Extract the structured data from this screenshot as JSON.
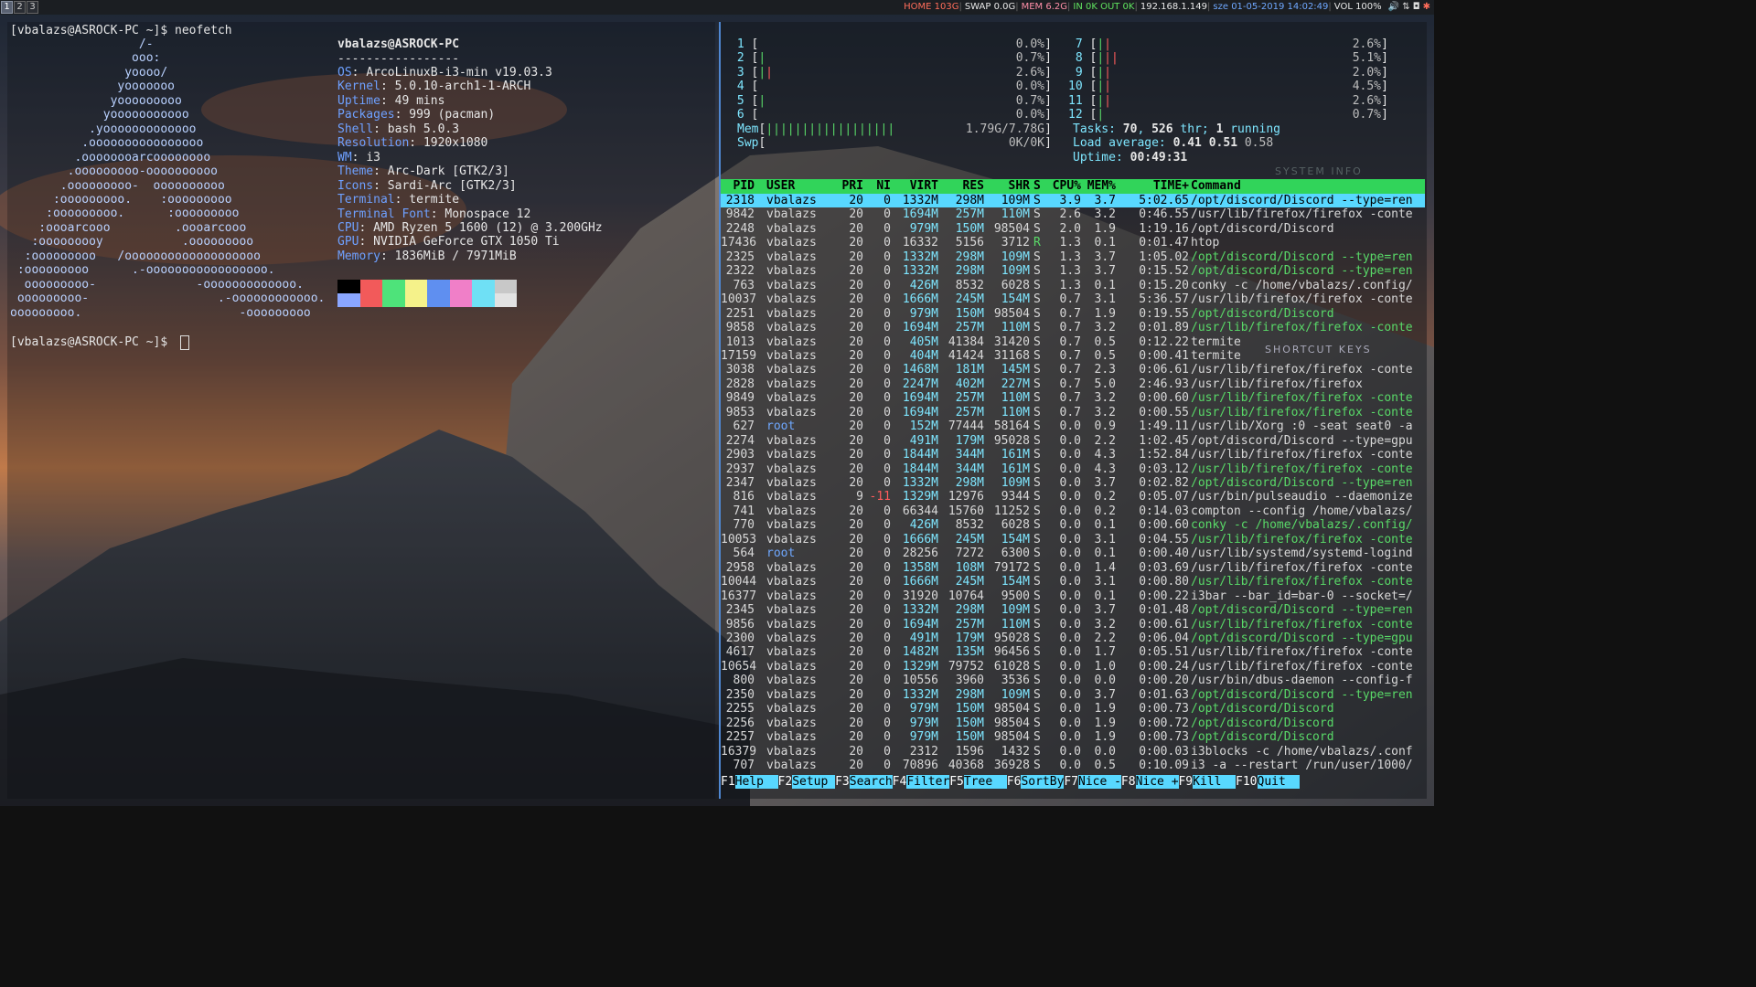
{
  "workspaces": [
    "1",
    "2",
    "3"
  ],
  "status_blocks": [
    {
      "text": "HOME 103G",
      "color": "#ff6d5a"
    },
    {
      "text": "SWAP 0.0G",
      "color": "#e8e8e8"
    },
    {
      "text": "MEM 6.2G",
      "color": "#ff8fa8"
    },
    {
      "text": "IN 0K OUT 0K",
      "color": "#5fe35f"
    },
    {
      "text": "192.168.1.149",
      "color": "#e8e8e8"
    },
    {
      "text": "sze 01-05-2019 14:02:49",
      "color": "#6fa8ff"
    },
    {
      "text": "VOL 100%",
      "color": "#e8e8e8"
    }
  ],
  "terminal": {
    "prompt1": "[vbalazs@ASROCK-PC ~]$ neofetch",
    "prompt2": "[vbalazs@ASROCK-PC ~]$ ",
    "ascii": [
      "                  /-",
      "                 ooo:",
      "                yoooo/",
      "               yooooooo",
      "              yooooooooo",
      "             yooooooooooo",
      "           .yooooooooooooo",
      "          .oooooooooooooooo",
      "         .oooooooarcoooooooo",
      "        .ooooooooo-oooooooooo",
      "       .ooooooooo-  oooooooooo",
      "      :ooooooooo.    :ooooooooo",
      "     :ooooooooo.      :ooooooooo",
      "    :oooarcooo         .oooarcooo",
      "   :ooooooooy           .ooooooooo",
      "  :ooooooooo   /ooooooooooooooooooo",
      " :ooooooooo      .-ooooooooooooooooo.",
      "  ooooooooo-              -ooooooooooooo.",
      " ooooooooo-                  .-oooooooooooo.",
      "ooooooooo.                      -ooooooooo"
    ],
    "user_host": "vbalazs@ASROCK-PC",
    "underline": "-----------------",
    "info": [
      {
        "key": "OS",
        "value": "ArcoLinuxB-i3-min v19.03.3"
      },
      {
        "key": "Kernel",
        "value": "5.0.10-arch1-1-ARCH"
      },
      {
        "key": "Uptime",
        "value": "49 mins"
      },
      {
        "key": "Packages",
        "value": "999 (pacman)"
      },
      {
        "key": "Shell",
        "value": "bash 5.0.3"
      },
      {
        "key": "Resolution",
        "value": "1920x1080"
      },
      {
        "key": "WM",
        "value": "i3"
      },
      {
        "key": "Theme",
        "value": "Arc-Dark [GTK2/3]"
      },
      {
        "key": "Icons",
        "value": "Sardi-Arc [GTK2/3]"
      },
      {
        "key": "Terminal",
        "value": "termite"
      },
      {
        "key": "Terminal Font",
        "value": "Monospace 12"
      },
      {
        "key": "CPU",
        "value": "AMD Ryzen 5 1600 (12) @ 3.200GHz"
      },
      {
        "key": "GPU",
        "value": "NVIDIA GeForce GTX 1050 Ti"
      },
      {
        "key": "Memory",
        "value": "1836MiB / 7971MiB"
      }
    ],
    "palette_top": [
      "#000000",
      "#f25a5a",
      "#4ee37a",
      "#f5f28a",
      "#5f8ff0",
      "#f07fc8",
      "#6fe0f5",
      "#c8c8c8"
    ],
    "palette_bottom": [
      "#8aa6ff",
      "#f25a5a",
      "#4ee37a",
      "#f5f28a",
      "#5f8ff0",
      "#f07fc8",
      "#6fe0f5",
      "#e2e2e2"
    ]
  },
  "htop": {
    "cpus_left": [
      {
        "n": "1",
        "bar": "",
        "pct": "0.0%"
      },
      {
        "n": "2",
        "bar": "|",
        "pct": "0.7%"
      },
      {
        "n": "3",
        "bar": "||",
        "pct": "2.6%"
      },
      {
        "n": "4",
        "bar": "",
        "pct": "0.0%"
      },
      {
        "n": "5",
        "bar": "|",
        "pct": "0.7%"
      },
      {
        "n": "6",
        "bar": "",
        "pct": "0.0%"
      }
    ],
    "cpus_right": [
      {
        "n": "7",
        "bar": "||",
        "pct": "2.6%"
      },
      {
        "n": "8",
        "bar": "|||",
        "pct": "5.1%"
      },
      {
        "n": "9",
        "bar": "||",
        "pct": "2.0%"
      },
      {
        "n": "10",
        "bar": "||",
        "pct": "4.5%"
      },
      {
        "n": "11",
        "bar": "||",
        "pct": "2.6%"
      },
      {
        "n": "12",
        "bar": "|",
        "pct": "0.7%"
      }
    ],
    "mem": {
      "label": "Mem",
      "bar": "||||||||||||||||||",
      "value": "1.79G/7.78G"
    },
    "swp": {
      "label": "Swp",
      "bar": "",
      "value": "0K/0K"
    },
    "tasks": {
      "label": "Tasks: ",
      "tasks": "70",
      "sep": ", ",
      "thr": "526",
      "thr_label": " thr; ",
      "running": "1",
      "running_label": " running"
    },
    "load": {
      "label": "Load average: ",
      "l1": "0.41",
      "l5": "0.51",
      "l15": "0.58"
    },
    "uptime": {
      "label": "Uptime: ",
      "value": "00:49:31"
    },
    "columns": [
      "PID",
      "USER",
      "PRI",
      "NI",
      "VIRT",
      "RES",
      "SHR",
      "S",
      "CPU%",
      "MEM%",
      "TIME+",
      "Command"
    ],
    "rows": [
      [
        "2318",
        "vbalazs",
        "20",
        "0",
        "1332M",
        "298M",
        "109M",
        "S",
        "3.9",
        "3.7",
        "5:02.65",
        "/opt/discord/Discord --type=ren",
        "hl"
      ],
      [
        "9842",
        "vbalazs",
        "20",
        "0",
        "1694M",
        "257M",
        "110M",
        "S",
        "2.6",
        "3.2",
        "0:46.55",
        "/usr/lib/firefox/firefox -conte",
        ""
      ],
      [
        "2248",
        "vbalazs",
        "20",
        "0",
        "979M",
        "150M",
        "98504",
        "S",
        "2.0",
        "1.9",
        "1:19.16",
        "/opt/discord/Discord",
        ""
      ],
      [
        "17436",
        "vbalazs",
        "20",
        "0",
        "16332",
        "5156",
        "3712",
        "R",
        "1.3",
        "0.1",
        "0:01.47",
        "htop",
        ""
      ],
      [
        "2325",
        "vbalazs",
        "20",
        "0",
        "1332M",
        "298M",
        "109M",
        "S",
        "1.3",
        "3.7",
        "1:05.02",
        "/opt/discord/Discord --type=ren",
        "thread"
      ],
      [
        "2322",
        "vbalazs",
        "20",
        "0",
        "1332M",
        "298M",
        "109M",
        "S",
        "1.3",
        "3.7",
        "0:15.52",
        "/opt/discord/Discord --type=ren",
        "thread"
      ],
      [
        "763",
        "vbalazs",
        "20",
        "0",
        "426M",
        "8532",
        "6028",
        "S",
        "1.3",
        "0.1",
        "0:15.20",
        "conky -c /home/vbalazs/.config/",
        ""
      ],
      [
        "10037",
        "vbalazs",
        "20",
        "0",
        "1666M",
        "245M",
        "154M",
        "S",
        "0.7",
        "3.1",
        "5:36.57",
        "/usr/lib/firefox/firefox -conte",
        ""
      ],
      [
        "2251",
        "vbalazs",
        "20",
        "0",
        "979M",
        "150M",
        "98504",
        "S",
        "0.7",
        "1.9",
        "0:19.55",
        "/opt/discord/Discord",
        "thread"
      ],
      [
        "9858",
        "vbalazs",
        "20",
        "0",
        "1694M",
        "257M",
        "110M",
        "S",
        "0.7",
        "3.2",
        "0:01.89",
        "/usr/lib/firefox/firefox -conte",
        "thread"
      ],
      [
        "1013",
        "vbalazs",
        "20",
        "0",
        "405M",
        "41384",
        "31420",
        "S",
        "0.7",
        "0.5",
        "0:12.22",
        "termite",
        ""
      ],
      [
        "17159",
        "vbalazs",
        "20",
        "0",
        "404M",
        "41424",
        "31168",
        "S",
        "0.7",
        "0.5",
        "0:00.41",
        "termite",
        ""
      ],
      [
        "3038",
        "vbalazs",
        "20",
        "0",
        "1468M",
        "181M",
        "145M",
        "S",
        "0.7",
        "2.3",
        "0:06.61",
        "/usr/lib/firefox/firefox -conte",
        ""
      ],
      [
        "2828",
        "vbalazs",
        "20",
        "0",
        "2247M",
        "402M",
        "227M",
        "S",
        "0.7",
        "5.0",
        "2:46.93",
        "/usr/lib/firefox/firefox",
        ""
      ],
      [
        "9849",
        "vbalazs",
        "20",
        "0",
        "1694M",
        "257M",
        "110M",
        "S",
        "0.7",
        "3.2",
        "0:00.60",
        "/usr/lib/firefox/firefox -conte",
        "thread"
      ],
      [
        "9853",
        "vbalazs",
        "20",
        "0",
        "1694M",
        "257M",
        "110M",
        "S",
        "0.7",
        "3.2",
        "0:00.55",
        "/usr/lib/firefox/firefox -conte",
        "thread"
      ],
      [
        "627",
        "root",
        "20",
        "0",
        "152M",
        "77444",
        "58164",
        "S",
        "0.0",
        "0.9",
        "1:49.11",
        "/usr/lib/Xorg :0 -seat seat0 -a",
        "root"
      ],
      [
        "2274",
        "vbalazs",
        "20",
        "0",
        "491M",
        "179M",
        "95028",
        "S",
        "0.0",
        "2.2",
        "1:02.45",
        "/opt/discord/Discord --type=gpu",
        ""
      ],
      [
        "2903",
        "vbalazs",
        "20",
        "0",
        "1844M",
        "344M",
        "161M",
        "S",
        "0.0",
        "4.3",
        "1:52.84",
        "/usr/lib/firefox/firefox -conte",
        ""
      ],
      [
        "2937",
        "vbalazs",
        "20",
        "0",
        "1844M",
        "344M",
        "161M",
        "S",
        "0.0",
        "4.3",
        "0:03.12",
        "/usr/lib/firefox/firefox -conte",
        "thread"
      ],
      [
        "2347",
        "vbalazs",
        "20",
        "0",
        "1332M",
        "298M",
        "109M",
        "S",
        "0.0",
        "3.7",
        "0:02.82",
        "/opt/discord/Discord --type=ren",
        "thread"
      ],
      [
        "816",
        "vbalazs",
        "9",
        "-11",
        "1329M",
        "12976",
        "9344",
        "S",
        "0.0",
        "0.2",
        "0:05.07",
        "/usr/bin/pulseaudio --daemonize",
        "nice"
      ],
      [
        "741",
        "vbalazs",
        "20",
        "0",
        "66344",
        "15760",
        "11252",
        "S",
        "0.0",
        "0.2",
        "0:14.03",
        "compton --config /home/vbalazs/",
        ""
      ],
      [
        "770",
        "vbalazs",
        "20",
        "0",
        "426M",
        "8532",
        "6028",
        "S",
        "0.0",
        "0.1",
        "0:00.60",
        "conky -c /home/vbalazs/.config/",
        "thread"
      ],
      [
        "10053",
        "vbalazs",
        "20",
        "0",
        "1666M",
        "245M",
        "154M",
        "S",
        "0.0",
        "3.1",
        "0:04.55",
        "/usr/lib/firefox/firefox -conte",
        "thread"
      ],
      [
        "564",
        "root",
        "20",
        "0",
        "28256",
        "7272",
        "6300",
        "S",
        "0.0",
        "0.1",
        "0:00.40",
        "/usr/lib/systemd/systemd-logind",
        "root"
      ],
      [
        "2958",
        "vbalazs",
        "20",
        "0",
        "1358M",
        "108M",
        "79172",
        "S",
        "0.0",
        "1.4",
        "0:03.69",
        "/usr/lib/firefox/firefox -conte",
        ""
      ],
      [
        "10044",
        "vbalazs",
        "20",
        "0",
        "1666M",
        "245M",
        "154M",
        "S",
        "0.0",
        "3.1",
        "0:00.80",
        "/usr/lib/firefox/firefox -conte",
        "thread"
      ],
      [
        "16377",
        "vbalazs",
        "20",
        "0",
        "31920",
        "10764",
        "9500",
        "S",
        "0.0",
        "0.1",
        "0:00.22",
        "i3bar --bar_id=bar-0 --socket=/",
        ""
      ],
      [
        "2345",
        "vbalazs",
        "20",
        "0",
        "1332M",
        "298M",
        "109M",
        "S",
        "0.0",
        "3.7",
        "0:01.48",
        "/opt/discord/Discord --type=ren",
        "thread"
      ],
      [
        "9856",
        "vbalazs",
        "20",
        "0",
        "1694M",
        "257M",
        "110M",
        "S",
        "0.0",
        "3.2",
        "0:00.61",
        "/usr/lib/firefox/firefox -conte",
        "thread"
      ],
      [
        "2300",
        "vbalazs",
        "20",
        "0",
        "491M",
        "179M",
        "95028",
        "S",
        "0.0",
        "2.2",
        "0:06.04",
        "/opt/discord/Discord --type=gpu",
        "thread"
      ],
      [
        "4617",
        "vbalazs",
        "20",
        "0",
        "1482M",
        "135M",
        "96456",
        "S",
        "0.0",
        "1.7",
        "0:05.51",
        "/usr/lib/firefox/firefox -conte",
        ""
      ],
      [
        "10654",
        "vbalazs",
        "20",
        "0",
        "1329M",
        "79752",
        "61028",
        "S",
        "0.0",
        "1.0",
        "0:00.24",
        "/usr/lib/firefox/firefox -conte",
        ""
      ],
      [
        "800",
        "vbalazs",
        "20",
        "0",
        "10556",
        "3960",
        "3536",
        "S",
        "0.0",
        "0.0",
        "0:00.20",
        "/usr/bin/dbus-daemon --config-f",
        ""
      ],
      [
        "2350",
        "vbalazs",
        "20",
        "0",
        "1332M",
        "298M",
        "109M",
        "S",
        "0.0",
        "3.7",
        "0:01.63",
        "/opt/discord/Discord --type=ren",
        "thread"
      ],
      [
        "2255",
        "vbalazs",
        "20",
        "0",
        "979M",
        "150M",
        "98504",
        "S",
        "0.0",
        "1.9",
        "0:00.73",
        "/opt/discord/Discord",
        "thread"
      ],
      [
        "2256",
        "vbalazs",
        "20",
        "0",
        "979M",
        "150M",
        "98504",
        "S",
        "0.0",
        "1.9",
        "0:00.72",
        "/opt/discord/Discord",
        "thread"
      ],
      [
        "2257",
        "vbalazs",
        "20",
        "0",
        "979M",
        "150M",
        "98504",
        "S",
        "0.0",
        "1.9",
        "0:00.73",
        "/opt/discord/Discord",
        "thread"
      ],
      [
        "16379",
        "vbalazs",
        "20",
        "0",
        "2312",
        "1596",
        "1432",
        "S",
        "0.0",
        "0.0",
        "0:00.03",
        "i3blocks -c /home/vbalazs/.conf",
        ""
      ],
      [
        "707",
        "vbalazs",
        "20",
        "0",
        "70896",
        "40368",
        "36928",
        "S",
        "0.0",
        "0.5",
        "0:10.09",
        "i3 -a --restart /run/user/1000/",
        ""
      ]
    ],
    "fkeys": [
      {
        "k": "F1",
        "l": "Help  "
      },
      {
        "k": "F2",
        "l": "Setup "
      },
      {
        "k": "F3",
        "l": "Search"
      },
      {
        "k": "F4",
        "l": "Filter"
      },
      {
        "k": "F5",
        "l": "Tree  "
      },
      {
        "k": "F6",
        "l": "SortBy"
      },
      {
        "k": "F7",
        "l": "Nice -"
      },
      {
        "k": "F8",
        "l": "Nice +"
      },
      {
        "k": "F9",
        "l": "Kill  "
      },
      {
        "k": "F10",
        "l": "Quit  "
      }
    ]
  },
  "conky": {
    "system_info": "SYSTEM INFO",
    "shortcut_keys": "SHORTCUT KEYS"
  }
}
